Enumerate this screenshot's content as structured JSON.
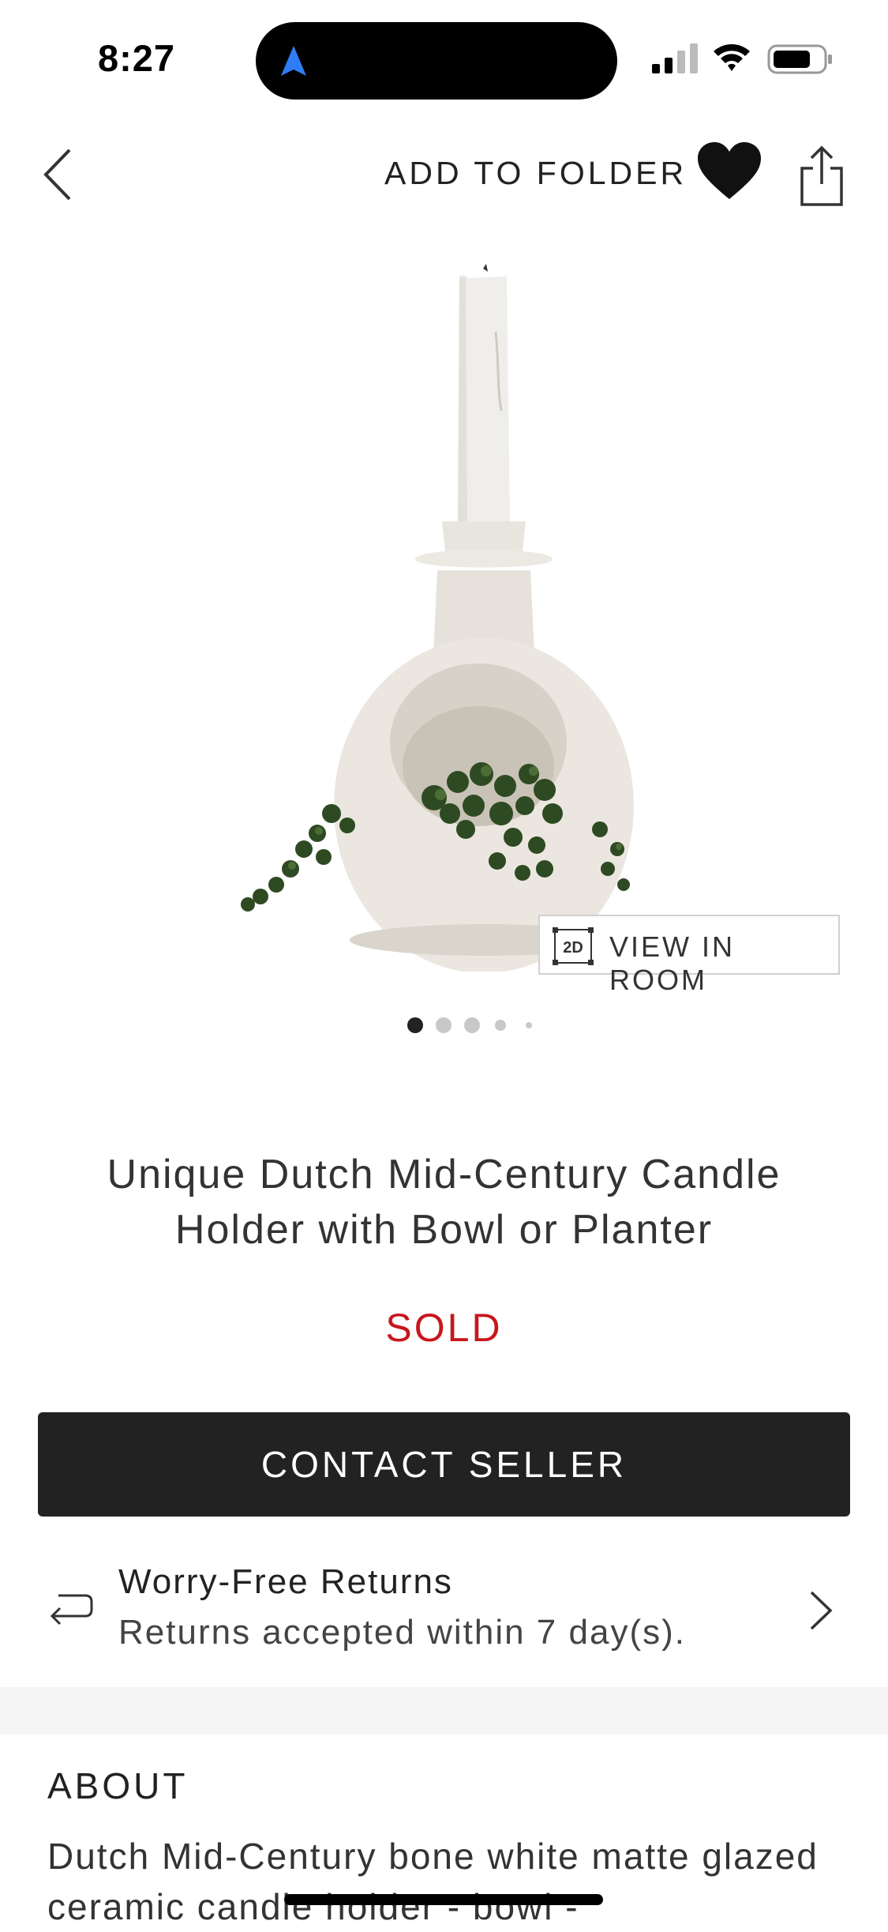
{
  "status_bar": {
    "time": "8:27"
  },
  "nav": {
    "add_to_folder": "ADD TO FOLDER"
  },
  "product": {
    "view_in_room_badge": "2D",
    "view_in_room_label": "VIEW IN ROOM",
    "image_count": 5,
    "active_image_index": 0,
    "title": "Unique Dutch Mid-Century Candle Holder with Bowl or Planter",
    "status": "SOLD"
  },
  "actions": {
    "contact_seller": "CONTACT SELLER"
  },
  "returns": {
    "title": "Worry-Free Returns",
    "subtitle": "Returns accepted within 7 day(s)."
  },
  "about": {
    "heading": "ABOUT",
    "text": "Dutch Mid-Century bone white matte glazed ceramic candle holder - bowl -"
  },
  "colors": {
    "sold": "#c8161d",
    "button_bg": "#222222",
    "nav_accent": "#2f7df6"
  }
}
